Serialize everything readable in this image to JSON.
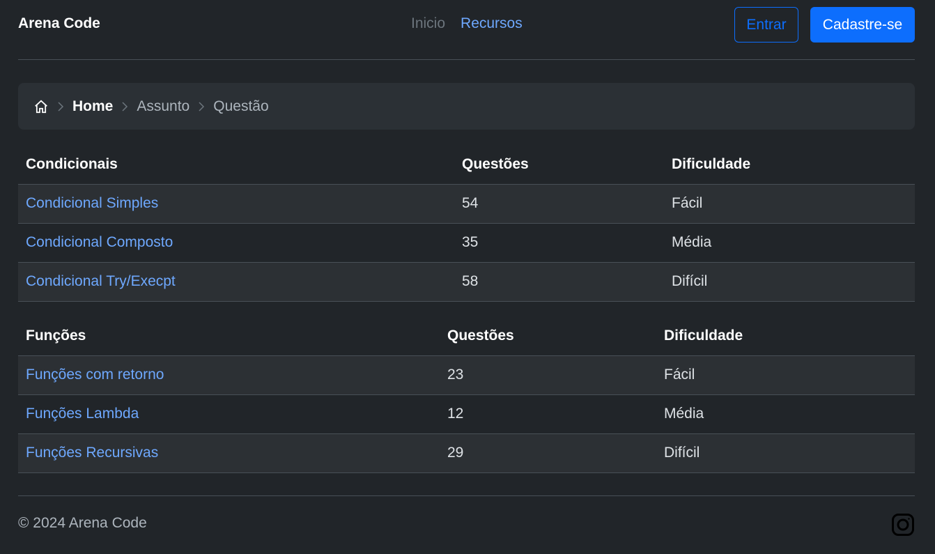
{
  "header": {
    "brand": "Arena Code",
    "nav": [
      {
        "label": "Inicio"
      },
      {
        "label": "Recursos"
      }
    ],
    "login_label": "Entrar",
    "signup_label": "Cadastre-se"
  },
  "breadcrumb": {
    "icon": "home-icon",
    "items": [
      "Home",
      "Assunto",
      "Questão"
    ]
  },
  "tables": [
    {
      "headers": [
        "Condicionais",
        "Questões",
        "Dificuldade"
      ],
      "rows": [
        {
          "name": "Condicional Simples",
          "count": "54",
          "difficulty": "Fácil"
        },
        {
          "name": "Condicional Composto",
          "count": "35",
          "difficulty": "Média"
        },
        {
          "name": "Condicional Try/Execpt",
          "count": "58",
          "difficulty": "Difícil"
        }
      ]
    },
    {
      "headers": [
        "Funções",
        "Questões",
        "Dificuldade"
      ],
      "rows": [
        {
          "name": "Funções com retorno",
          "count": "23",
          "difficulty": "Fácil"
        },
        {
          "name": "Funções Lambda",
          "count": "12",
          "difficulty": "Média"
        },
        {
          "name": "Funções Recursivas",
          "count": "29",
          "difficulty": "Difícil"
        }
      ]
    }
  ],
  "footer": {
    "copyright": "© 2024 Arena Code",
    "social_icon": "instagram-icon"
  },
  "colors": {
    "background": "#212529",
    "accent": "#0d6efd",
    "link": "#6ea8fe"
  }
}
